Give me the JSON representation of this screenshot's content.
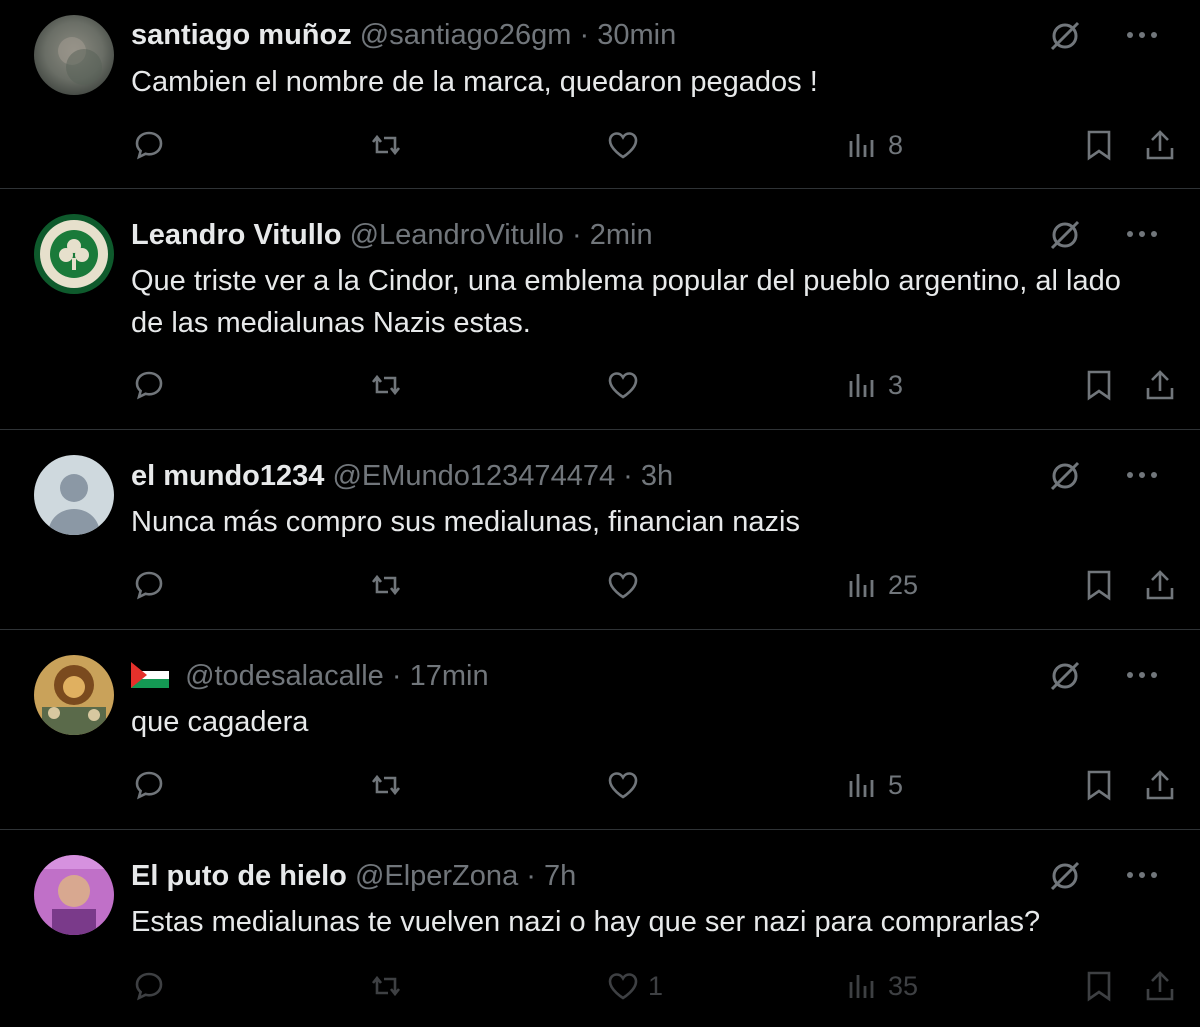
{
  "tweets": [
    {
      "name": "santiago muñoz",
      "handle": "@santiago26gm",
      "time": "30min",
      "text": "Cambien el nombre de la marca, quedaron pegados !",
      "views": "8",
      "likes": "",
      "avatar": "grey-blurry-avatar"
    },
    {
      "name": "Leandro Vitullo",
      "handle": "@LeandroVitullo",
      "time": "2min",
      "text": "Que triste ver a la Cindor, una emblema popular del pueblo argentino, al lado de las medialunas Nazis estas.",
      "views": "3",
      "likes": "",
      "avatar": "celtics-logo-avatar"
    },
    {
      "name": "el mundo1234",
      "handle": "@EMundo123474474",
      "time": "3h",
      "text": "Nunca más compro sus medialunas, financian nazis",
      "views": "25",
      "likes": "",
      "avatar": "default-person-avatar"
    },
    {
      "name": "",
      "handle": "@todesalacalle",
      "time": "17min",
      "text": "que cagadera",
      "views": "5",
      "likes": "",
      "avatar": "illustration-avatar",
      "flag": "palestine-flag-icon"
    },
    {
      "name": "El puto de hielo",
      "handle": "@ElperZona",
      "time": "7h",
      "text": "Estas medialunas te vuelven nazi o hay que ser nazi para comprarlas?",
      "views": "35",
      "likes": "1",
      "avatar": "pink-photo-avatar"
    }
  ],
  "dot": "·",
  "colors": {
    "background": "#000000",
    "text": "#e7e9ea",
    "muted": "#71767b",
    "divider": "#2f3336"
  }
}
